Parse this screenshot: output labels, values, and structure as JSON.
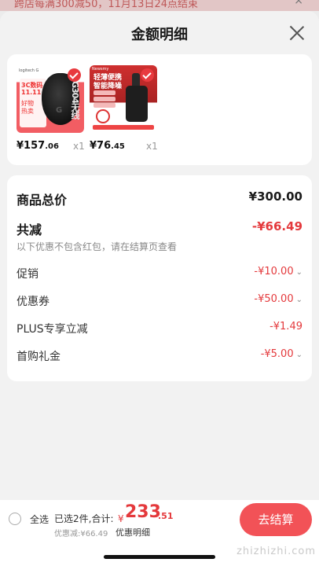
{
  "top_strip": {
    "text": "跨店每满300减50，11月13日24点结束",
    "close": "×"
  },
  "sheet": {
    "title": "金额明细"
  },
  "products": [
    {
      "price_int": "¥157",
      "price_dec": ".06",
      "qty": "x1",
      "thumb_texts": [
        "logitech G",
        "3C数码",
        "11.11",
        "好物",
        "热卖",
        "G",
        "G304无线"
      ]
    },
    {
      "price_int": "¥76",
      "price_dec": ".45",
      "qty": "x1",
      "thumb_texts": [
        "Newsmy",
        "轻薄便携",
        "智能降噪"
      ]
    }
  ],
  "summary": {
    "total_label": "商品总价",
    "total_value": "¥300.00",
    "reduce_label": "共减",
    "reduce_value": "-¥66.49",
    "note": "以下优惠不包含红包，请在结算页查看",
    "items": [
      {
        "label": "促销",
        "value": "-¥10.00",
        "has_chevron": true
      },
      {
        "label": "优惠券",
        "value": "-¥50.00",
        "has_chevron": true
      },
      {
        "label": "PLUS专享立减",
        "value": "-¥1.49",
        "has_chevron": false
      },
      {
        "label": "首购礼金",
        "value": "-¥5.00",
        "has_chevron": true
      }
    ]
  },
  "footer": {
    "select_all": "全选",
    "selected": "已选2件,合计:",
    "currency": "¥",
    "total_int": "233",
    "total_dec": ".51",
    "discount": "优惠减:¥66.49",
    "detail_link": "优惠明细",
    "checkout": "去结算",
    "watermark": "zhizhizhi.com"
  },
  "colors": {
    "accent": "#e4393c",
    "button": "#f0343a",
    "background": "#f2f2f2"
  }
}
